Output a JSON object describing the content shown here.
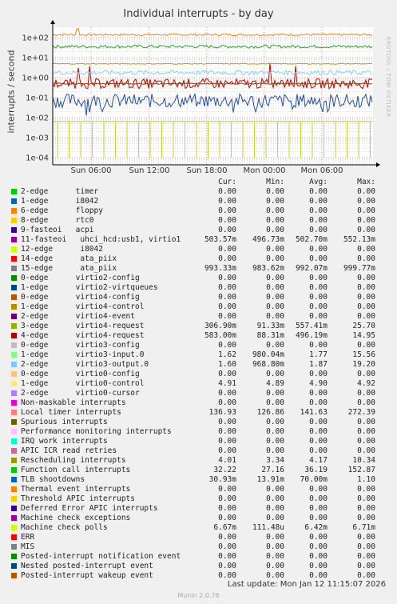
{
  "chart_data": {
    "type": "line",
    "title": "Individual interrupts - by day",
    "ylabel": "interrupts / second",
    "yscale": "log",
    "ylim": [
      5e-05,
      300
    ],
    "yticks": [
      "1e+02",
      "1e+01",
      "1e+00",
      "1e-01",
      "1e-02",
      "1e-03",
      "1e-04"
    ],
    "xticks": [
      "Sun 06:00",
      "Sun 12:00",
      "Sun 18:00",
      "Mon 00:00",
      "Mon 06:00"
    ],
    "grid": true,
    "series": [
      {
        "name": "Local timer interrupts",
        "color": "#ff7f0e",
        "level": 140
      },
      {
        "name": "Function call interrupts",
        "color": "#2ca02c",
        "level": 36
      },
      {
        "name": "Machine check polls",
        "color": "#bcdb22",
        "level": 0.0064
      },
      {
        "name": "TLB shootdowns",
        "color": "#1f4f9f",
        "level": 0.07
      },
      {
        "name": "virtio4-request",
        "color": "#cc0000",
        "level": 0.5
      },
      {
        "name": "virtio3-input.0",
        "color": "#7fd3f0",
        "level": 1.8
      },
      {
        "name": "virtio0-control",
        "color": "#c49b00",
        "level": 4.9
      },
      {
        "name": "11-fasteoi uhci_hcd:usb1, virtio1",
        "color": "#7f3f00",
        "level": 0.5
      }
    ]
  },
  "side_tag": "RRDTOOL / TOBI OETIKER",
  "legend": {
    "headers": {
      "cur": "Cur:",
      "min": "Min:",
      "avg": "Avg:",
      "max": "Max:"
    },
    "rows": [
      {
        "name": "2-edge      timer",
        "color": "#00cc00",
        "cur": "0.00",
        "min": "0.00",
        "avg": "0.00",
        "max": "0.00"
      },
      {
        "name": "1-edge      i8042",
        "color": "#0066b3",
        "cur": "0.00",
        "min": "0.00",
        "avg": "0.00",
        "max": "0.00"
      },
      {
        "name": "6-edge      floppy",
        "color": "#ff8000",
        "cur": "0.00",
        "min": "0.00",
        "avg": "0.00",
        "max": "0.00"
      },
      {
        "name": "8-edge      rtc0",
        "color": "#ffcc00",
        "cur": "0.00",
        "min": "0.00",
        "avg": "0.00",
        "max": "0.00"
      },
      {
        "name": "9-fasteoi   acpi",
        "color": "#330099",
        "cur": "0.00",
        "min": "0.00",
        "avg": "0.00",
        "max": "0.00"
      },
      {
        "name": "11-fasteoi   uhci_hcd:usb1, virtio1",
        "color": "#990099",
        "cur": "503.57m",
        "min": "496.73m",
        "avg": "502.70m",
        "max": "552.13m"
      },
      {
        "name": "12-edge      i8042",
        "color": "#ccff00",
        "cur": "0.00",
        "min": "0.00",
        "avg": "0.00",
        "max": "0.00"
      },
      {
        "name": "14-edge      ata_piix",
        "color": "#ff0000",
        "cur": "0.00",
        "min": "0.00",
        "avg": "0.00",
        "max": "0.00"
      },
      {
        "name": "15-edge      ata_piix",
        "color": "#808080",
        "cur": "993.33m",
        "min": "983.62m",
        "avg": "992.07m",
        "max": "999.77m"
      },
      {
        "name": "0-edge      virtio2-config",
        "color": "#008f00",
        "cur": "0.00",
        "min": "0.00",
        "avg": "0.00",
        "max": "0.00"
      },
      {
        "name": "1-edge      virtio2-virtqueues",
        "color": "#00487d",
        "cur": "0.00",
        "min": "0.00",
        "avg": "0.00",
        "max": "0.00"
      },
      {
        "name": "0-edge      virtio4-config",
        "color": "#b35a00",
        "cur": "0.00",
        "min": "0.00",
        "avg": "0.00",
        "max": "0.00"
      },
      {
        "name": "1-edge      virtio4-control",
        "color": "#b38f00",
        "cur": "0.00",
        "min": "0.00",
        "avg": "0.00",
        "max": "0.00"
      },
      {
        "name": "2-edge      virtio4-event",
        "color": "#6b006b",
        "cur": "0.00",
        "min": "0.00",
        "avg": "0.00",
        "max": "0.00"
      },
      {
        "name": "3-edge      virtio4-request",
        "color": "#8fb300",
        "cur": "306.90m",
        "min": "91.33m",
        "avg": "557.41m",
        "max": "25.70"
      },
      {
        "name": "4-edge      virtio4-request",
        "color": "#b30000",
        "cur": "583.00m",
        "min": "88.31m",
        "avg": "496.19m",
        "max": "14.95"
      },
      {
        "name": "0-edge      virtio3-config",
        "color": "#bebebe",
        "cur": "0.00",
        "min": "0.00",
        "avg": "0.00",
        "max": "0.00"
      },
      {
        "name": "1-edge      virtio3-input.0",
        "color": "#80ff80",
        "cur": "1.62",
        "min": "980.04m",
        "avg": "1.77",
        "max": "15.56"
      },
      {
        "name": "2-edge      virtio3-output.0",
        "color": "#80c9ff",
        "cur": "1.60",
        "min": "968.80m",
        "avg": "1.87",
        "max": "19.20"
      },
      {
        "name": "0-edge      virtio0-config",
        "color": "#ffc080",
        "cur": "0.00",
        "min": "0.00",
        "avg": "0.00",
        "max": "0.00"
      },
      {
        "name": "1-edge      virtio0-control",
        "color": "#ffe680",
        "cur": "4.91",
        "min": "4.89",
        "avg": "4.90",
        "max": "4.92"
      },
      {
        "name": "2-edge      virtio0-cursor",
        "color": "#aa80ff",
        "cur": "0.00",
        "min": "0.00",
        "avg": "0.00",
        "max": "0.00"
      },
      {
        "name": "Non-maskable interrupts",
        "color": "#ee00cc",
        "cur": "0.00",
        "min": "0.00",
        "avg": "0.00",
        "max": "0.00"
      },
      {
        "name": "Local timer interrupts",
        "color": "#ff8080",
        "cur": "136.93",
        "min": "126.86",
        "avg": "141.63",
        "max": "272.39"
      },
      {
        "name": "Spurious interrupts",
        "color": "#666600",
        "cur": "0.00",
        "min": "0.00",
        "avg": "0.00",
        "max": "0.00"
      },
      {
        "name": "Performance monitoring interrupts",
        "color": "#ffbfff",
        "cur": "0.00",
        "min": "0.00",
        "avg": "0.00",
        "max": "0.00"
      },
      {
        "name": "IRQ work interrupts",
        "color": "#00ffcc",
        "cur": "0.00",
        "min": "0.00",
        "avg": "0.00",
        "max": "0.00"
      },
      {
        "name": "APIC ICR read retries",
        "color": "#cc6699",
        "cur": "0.00",
        "min": "0.00",
        "avg": "0.00",
        "max": "0.00"
      },
      {
        "name": "Rescheduling interrupts",
        "color": "#999900",
        "cur": "4.01",
        "min": "3.34",
        "avg": "4.17",
        "max": "10.34"
      },
      {
        "name": "Function call interrupts",
        "color": "#00cc00",
        "cur": "32.22",
        "min": "27.16",
        "avg": "36.19",
        "max": "152.87"
      },
      {
        "name": "TLB shootdowns",
        "color": "#0066b3",
        "cur": "30.93m",
        "min": "13.91m",
        "avg": "70.00m",
        "max": "1.10"
      },
      {
        "name": "Thermal event interrupts",
        "color": "#ff8000",
        "cur": "0.00",
        "min": "0.00",
        "avg": "0.00",
        "max": "0.00"
      },
      {
        "name": "Threshold APIC interrupts",
        "color": "#ffcc00",
        "cur": "0.00",
        "min": "0.00",
        "avg": "0.00",
        "max": "0.00"
      },
      {
        "name": "Deferred Error APIC interrupts",
        "color": "#330099",
        "cur": "0.00",
        "min": "0.00",
        "avg": "0.00",
        "max": "0.00"
      },
      {
        "name": "Machine check exceptions",
        "color": "#990099",
        "cur": "0.00",
        "min": "0.00",
        "avg": "0.00",
        "max": "0.00"
      },
      {
        "name": "Machine check polls",
        "color": "#ccff00",
        "cur": "6.67m",
        "min": "111.48u",
        "avg": "6.42m",
        "max": "6.71m"
      },
      {
        "name": "ERR",
        "color": "#ff0000",
        "cur": "0.00",
        "min": "0.00",
        "avg": "0.00",
        "max": "0.00"
      },
      {
        "name": "MIS",
        "color": "#808080",
        "cur": "0.00",
        "min": "0.00",
        "avg": "0.00",
        "max": "0.00"
      },
      {
        "name": "Posted-interrupt notification event",
        "color": "#008f00",
        "cur": "0.00",
        "min": "0.00",
        "avg": "0.00",
        "max": "0.00"
      },
      {
        "name": "Nested posted-interrupt event",
        "color": "#00487d",
        "cur": "0.00",
        "min": "0.00",
        "avg": "0.00",
        "max": "0.00"
      },
      {
        "name": "Posted-interrupt wakeup event",
        "color": "#b35a00",
        "cur": "0.00",
        "min": "0.00",
        "avg": "0.00",
        "max": "0.00"
      }
    ]
  },
  "last_update": "Last update: Mon Jan 12 11:15:07 2026",
  "footer": "Munin 2.0.76"
}
